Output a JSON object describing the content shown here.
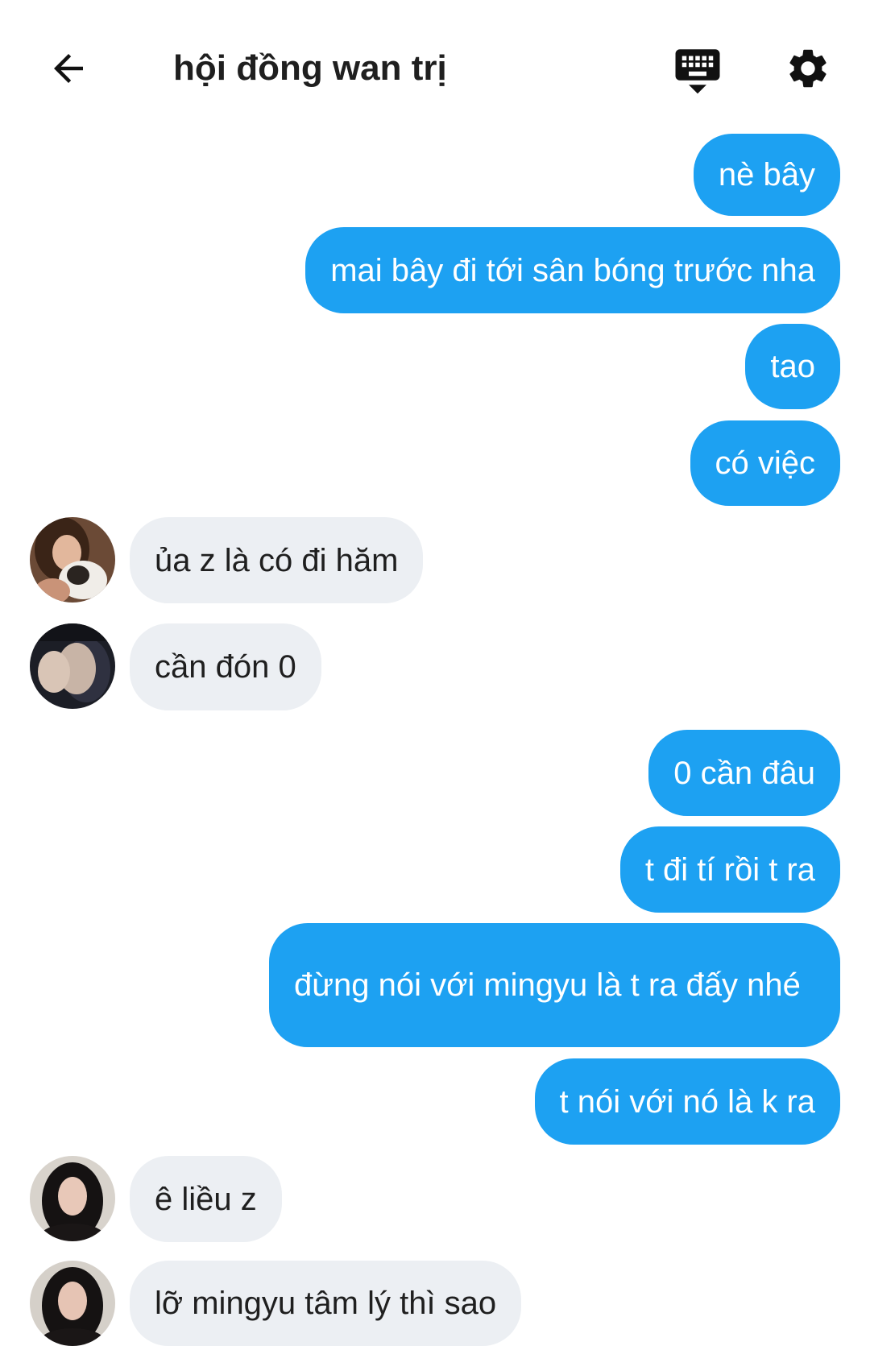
{
  "header": {
    "title": "hội đồng wan trị",
    "back_icon": "arrow-left-icon",
    "keyboard_icon": "keyboard-hide-icon",
    "settings_icon": "gear-icon"
  },
  "colors": {
    "outgoing_bubble": "#1da1f2",
    "incoming_bubble": "#eceff3",
    "outgoing_text": "#ffffff",
    "incoming_text": "#1f1f1f"
  },
  "messages": [
    {
      "direction": "outgoing",
      "text": "nè bây"
    },
    {
      "direction": "outgoing",
      "text": "mai bây đi tới sân bóng trước nha"
    },
    {
      "direction": "outgoing",
      "text": "tao"
    },
    {
      "direction": "outgoing",
      "text": "có việc"
    },
    {
      "direction": "incoming",
      "text": "ủa z là có đi hăm"
    },
    {
      "direction": "incoming",
      "text": "cần đón 0"
    },
    {
      "direction": "outgoing",
      "text": "0 cần đâu"
    },
    {
      "direction": "outgoing",
      "text": "t đi tí rồi t ra"
    },
    {
      "direction": "outgoing",
      "text": "đừng nói với mingyu là t ra đấy nhé"
    },
    {
      "direction": "outgoing",
      "text": "t nói với nó là k ra"
    },
    {
      "direction": "incoming",
      "text": "ê liều z"
    },
    {
      "direction": "incoming",
      "text": "lỡ mingyu tâm lý thì sao"
    }
  ]
}
